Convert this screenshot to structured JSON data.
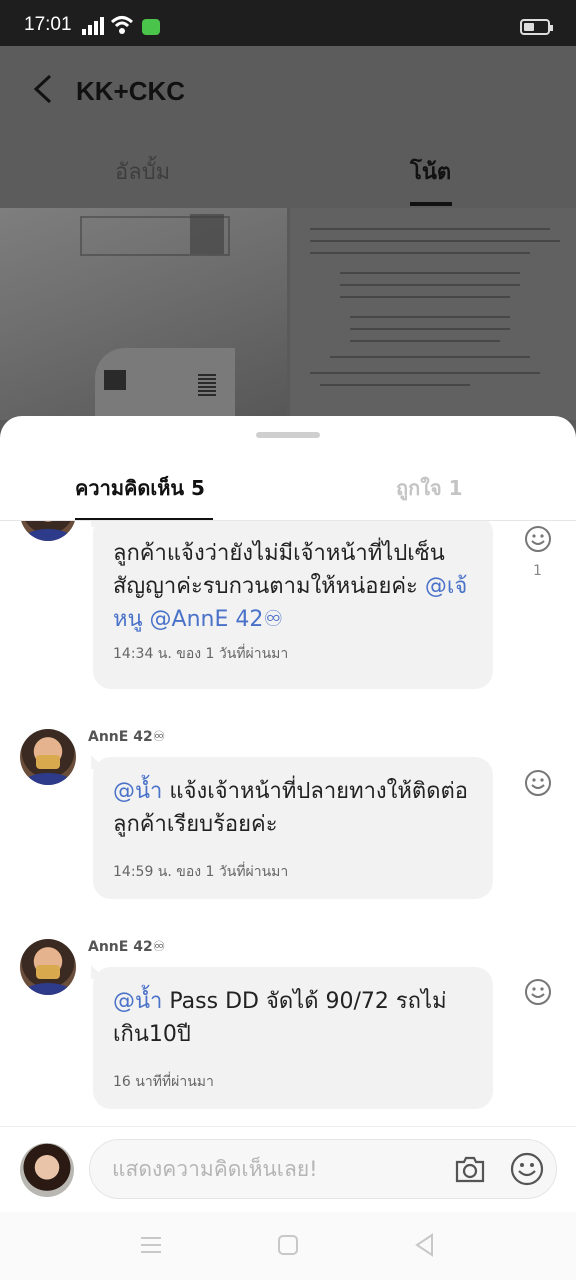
{
  "status_bar": {
    "time": "17:01"
  },
  "header": {
    "title": "KK+CKC",
    "tabs": [
      "อัลบั้ม",
      "โน้ต"
    ]
  },
  "sheet": {
    "tabs": {
      "comments": "ความคิดเห็น 5",
      "likes": "ถูกใจ 1"
    },
    "comments": [
      {
        "author": "",
        "text": "ลูกค้าแจ้งว่ายังไม่มีเจ้าหน้าที่ไปเซ็นสัญญาค่ะรบกวนตามให้หน่อยค่ะ ",
        "mention": "@เจ้หนู @AnnE 42♾",
        "time": "14:34 น. ของ 1 วันที่ผ่านมา",
        "reaction_count": "1"
      },
      {
        "author": "AnnE 42♾",
        "mention": "@น้ำ",
        "text": " แจ้งเจ้าหน้าที่ปลายทางให้ติดต่อลูกค้าเรียบร้อยค่ะ",
        "time": "14:59 น. ของ 1 วันที่ผ่านมา"
      },
      {
        "author": "AnnE 42♾",
        "mention": "@น้ำ",
        "text": " Pass DD จัดได้ 90/72 รถไม่เกิน10ปี",
        "time": "16 นาทีที่ผ่านมา"
      }
    ],
    "composer": {
      "placeholder": "แสดงความคิดเห็นเลย!"
    }
  },
  "icons": [
    "back-icon",
    "smiley-icon",
    "camera-icon",
    "menu-icon",
    "home-icon",
    "back-triangle-icon"
  ]
}
